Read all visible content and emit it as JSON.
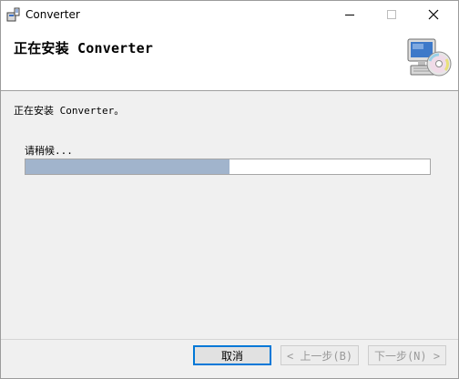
{
  "window": {
    "title": "Converter",
    "app_icon": "installer-icon",
    "caption_buttons": [
      "minimize-icon",
      "maximize-icon",
      "close-icon"
    ]
  },
  "header": {
    "title": "正在安装 Converter",
    "graphic_icon": "computer-cd-icon"
  },
  "body": {
    "install_message": "正在安装 Converter。",
    "status_label": "请稍候...",
    "progress_fraction": 0.505,
    "progress_color": "#a1b4cc"
  },
  "footer": {
    "cancel_label": "取消",
    "back_label": "< 上一步(B)",
    "next_label": "下一步(N) >"
  }
}
